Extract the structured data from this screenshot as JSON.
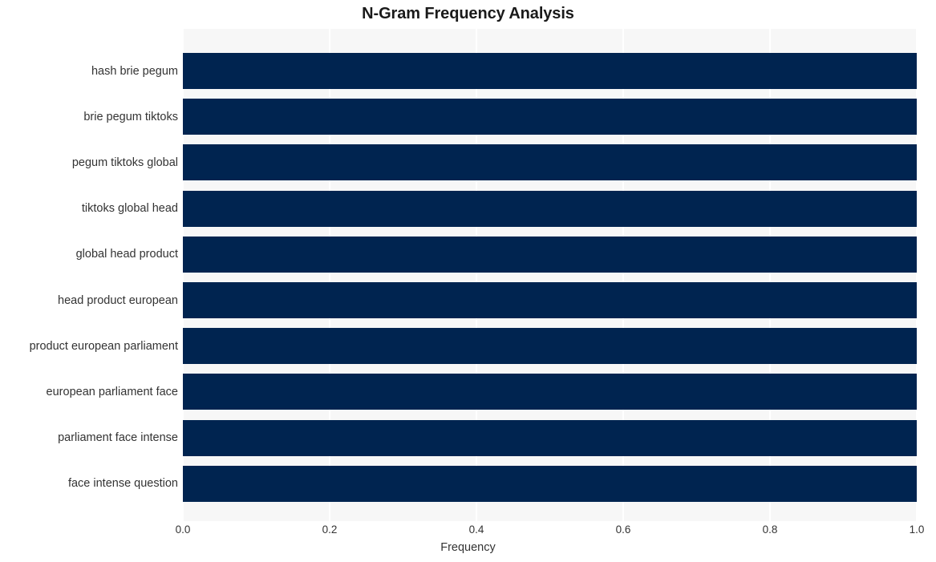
{
  "chart_data": {
    "type": "bar",
    "orientation": "horizontal",
    "title": "N-Gram Frequency Analysis",
    "xlabel": "Frequency",
    "ylabel": "",
    "categories": [
      "hash brie pegum",
      "brie pegum tiktoks",
      "pegum tiktoks global",
      "tiktoks global head",
      "global head product",
      "head product european",
      "product european parliament",
      "european parliament face",
      "parliament face intense",
      "face intense question"
    ],
    "values": [
      1.0,
      1.0,
      1.0,
      1.0,
      1.0,
      1.0,
      1.0,
      1.0,
      1.0,
      1.0
    ],
    "xlim": [
      0.0,
      1.0
    ],
    "xticks": [
      0.0,
      0.2,
      0.4,
      0.6,
      0.8,
      1.0
    ],
    "xtick_labels": [
      "0.0",
      "0.2",
      "0.4",
      "0.6",
      "0.8",
      "1.0"
    ],
    "grid": true,
    "grid_axis": "x",
    "legend": false,
    "bar_color": "#002450",
    "plot_background": "#f7f7f7",
    "figure_background": "#ffffff",
    "gridline_color": "#ffffff",
    "text_color": "#333333",
    "title_color": "#1a1a1a"
  }
}
